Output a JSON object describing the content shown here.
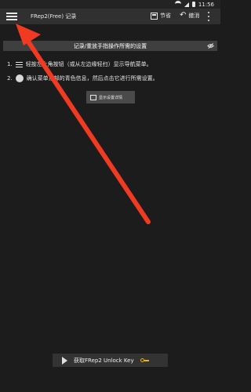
{
  "status_bar": {
    "time": "11:56"
  },
  "app_bar": {
    "title": "FRep2(Free) 记录",
    "save_label": "节省",
    "undo_label": "撤消"
  },
  "banner": {
    "text": "记录/重放手指操作所需的设置"
  },
  "steps": [
    {
      "number": "1.",
      "before": "轻按左上角按钮（或从左边缘轻扫）显示导航菜单。"
    },
    {
      "number": "2.",
      "before": "确认菜单顶部的青色信息，然后点击它进行所需设置。"
    }
  ],
  "show_details": {
    "label": "显示设置详情"
  },
  "unlock": {
    "label": "获取FRep2 Unlock Key"
  },
  "colors": {
    "annotation_arrow": "#f03a22",
    "key_icon": "#f0b400"
  }
}
